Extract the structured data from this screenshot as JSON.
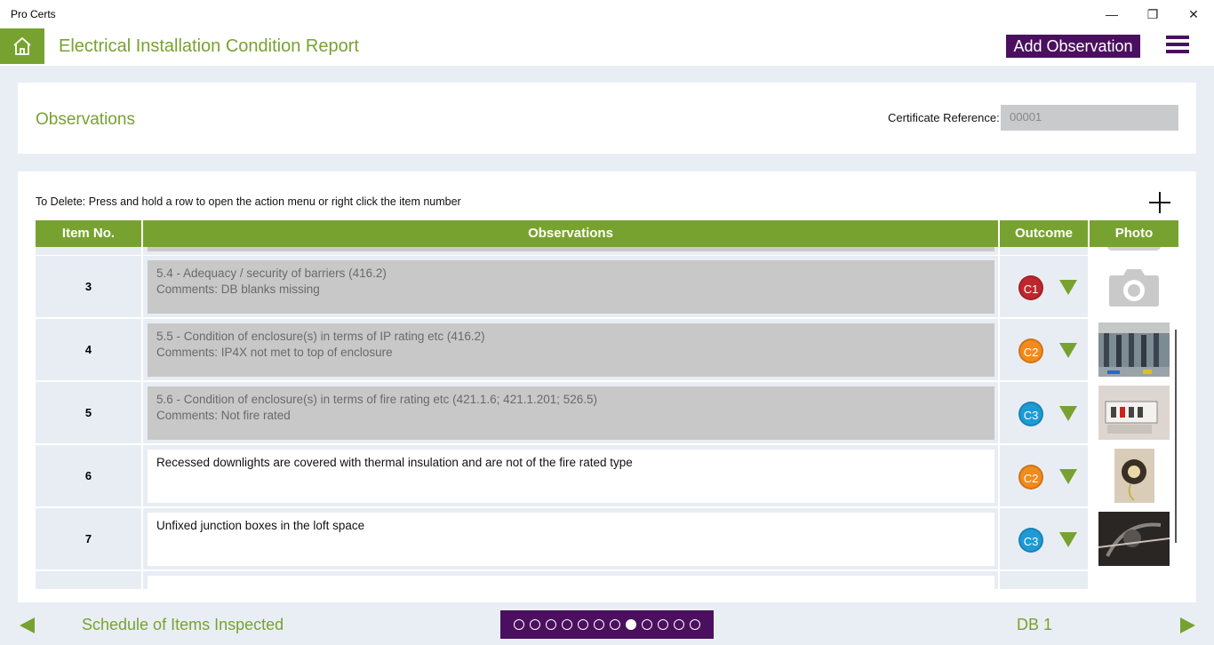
{
  "window": {
    "title": "Pro Certs",
    "minimize": "—",
    "restore": "❐",
    "close": "✕"
  },
  "header": {
    "title": "Electrical Installation Condition Report",
    "add_observation": "Add Observation",
    "home_icon": "home-icon",
    "menu_icon": "hamburger-menu-icon"
  },
  "section": {
    "title": "Observations",
    "cert_ref_label": "Certificate Reference:",
    "cert_ref_value": "00001"
  },
  "table": {
    "hint": "To Delete: Press and hold a row to open the action menu or right click the item number",
    "headers": [
      "Item No.",
      "Observations",
      "Outcome",
      "Photo"
    ],
    "rows": [
      {
        "item": "3",
        "line1": "5.4 - Adequacy / security of barriers (416.2)",
        "line2": "Comments: DB blanks missing",
        "style": "grey",
        "outcome": "C1",
        "color": "#c0262d",
        "photo": "camera-placeholder"
      },
      {
        "item": "4",
        "line1": "5.5 - Condition of enclosure(s) in terms of IP rating etc (416.2)",
        "line2": "Comments: IP4X not met to top of enclosure",
        "style": "grey",
        "outcome": "C2",
        "color": "#f28a1c",
        "photo": "photo"
      },
      {
        "item": "5",
        "line1": "5.6 - Condition of enclosure(s) in terms of fire rating etc (421.1.6; 421.1.201; 526.5)",
        "line2": "Comments: Not fire rated",
        "style": "grey",
        "outcome": "C3",
        "color": "#1e9ad6",
        "photo": "photo"
      },
      {
        "item": "6",
        "line1": "Recessed downlights are covered with thermal insulation and are not of the fire rated type",
        "line2": "",
        "style": "white",
        "outcome": "C2",
        "color": "#f28a1c",
        "photo": "photo"
      },
      {
        "item": "7",
        "line1": "Unfixed junction boxes in the loft space",
        "line2": "",
        "style": "white",
        "outcome": "C3",
        "color": "#1e9ad6",
        "photo": "photo"
      }
    ]
  },
  "footer": {
    "prev_label": "Schedule of Items Inspected",
    "next_label": "DB 1",
    "pages_total": 12,
    "page_active": 8
  },
  "colors": {
    "brand_green": "#78a22f",
    "brand_purple": "#4b0f5f"
  }
}
